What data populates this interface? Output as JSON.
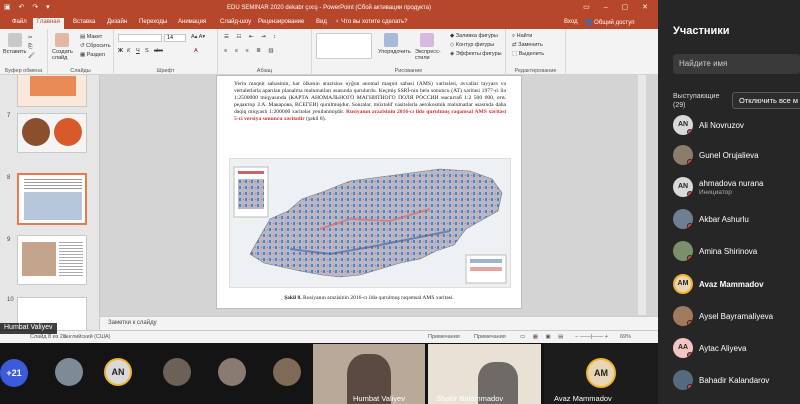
{
  "ppt": {
    "title": "EDU SEMINAR 2020 dekabr çıxış - PowerPoint (Сбой активации продукта)",
    "tabs": [
      "Файл",
      "Главная",
      "Вставка",
      "Дизайн",
      "Переходы",
      "Анимация",
      "Слайд-шоу",
      "Рецензирование",
      "Вид"
    ],
    "active_tab": "Главная",
    "tell_me": "♀ Что вы хотите сделать?",
    "sign_in": "Вход",
    "share": "Общий доступ",
    "ribbon": {
      "paste": "Вставить",
      "create_slide": "Создать слайд",
      "layout": "Макет",
      "reset": "Сбросить",
      "section": "Раздел",
      "font_size": "14",
      "arrange": "Упорядочить",
      "quick_styles": "Экспресс-стили",
      "shape_fill": "Заливка фигуры",
      "shape_outline": "Контур фигуры",
      "shape_effects": "Эффекты фигуры",
      "find": "Найти",
      "replace": "Заменить",
      "select": "Выделить",
      "groups": [
        "Буфер обмена",
        "Слайды",
        "Шрифт",
        "Абзац",
        "Рисование",
        "Редактирование"
      ]
    },
    "thumb_numbers": [
      "7",
      "8",
      "9",
      "10"
    ],
    "slide": {
      "paragraph": "Yerin maqnit sahəsinin, hər ölkənin ərazisinə uyğun anomal maqnit sahəsi (AMS) xəritələri, avvallar tayyarə və vertaletlərla aparılan planalma məlumatları əsasında qurulurdu. Keçmiş SSRİ-nin belə sonuncu (AT) xəritəsi 1977-ci ilə 1:2500000 miqyasında (КАРТА АНОМАЛЬНОГО МАГНИТНОГО ПОЛЯ РОССИИ масштаб 1:2 500 000, отв. редактор З.А. Макарова, ВСЕГЕИ) qurulmuşdur. Sonralar, müxtəlif vasitələrlə aerokosmik məlumatlar əsasında daha dəqiq miqyaslı 1:200000 xəritələr yenilənmişdir.",
      "red_text": "Rusiyanın ərazisinin 2016-cı ildə qurulmuş rəqəmsal AMS xəritəsi 5-ci versiya sonuncu xəritədir",
      "after_red": " (şəkil 8).",
      "caption_bold": "Şəkil 8.",
      "caption": " Rusiyanın ərazisinin 2016-cı ildə qurulmuş rəqəmsal AMS xəritəsi."
    },
    "notes": "Заметки к слайду",
    "status": {
      "slide": "Слайд 8 из 28",
      "lang": "английский (США)",
      "notes_btn": "Примечания",
      "comments_btn": "Примечания",
      "zoom": "69%"
    },
    "presenter_badge": "Humbat Valiyev"
  },
  "participants": {
    "title": "Участники",
    "search_placeholder": "Найдите имя",
    "speakers_label": "Выступающие",
    "speakers_count": "(29)",
    "mute_all": "Отключить все м",
    "list": [
      {
        "initials": "AN",
        "name": "Ali Novruzov",
        "role": "",
        "color": "#d9d9d9"
      },
      {
        "initials": "",
        "name": "Gunel Orujalieva",
        "role": "",
        "color": "#8b7d6b"
      },
      {
        "initials": "AN",
        "name": "ahmadova nurana",
        "role": "Инициатор",
        "color": "#d9d9d9"
      },
      {
        "initials": "",
        "name": "Akbar Ashurlu",
        "role": "",
        "color": "#6e7f92"
      },
      {
        "initials": "",
        "name": "Amina Shirinova",
        "role": "",
        "color": "#7a8f6a"
      },
      {
        "initials": "AM",
        "name": "Avaz Mammadov",
        "role": "",
        "color": "#e8d5b5"
      },
      {
        "initials": "",
        "name": "Aysel Bayramaliyeva",
        "role": "",
        "color": "#a07a5a"
      },
      {
        "initials": "AA",
        "name": "Aytac Aliyeva",
        "role": "",
        "color": "#f2c4c4"
      },
      {
        "initials": "",
        "name": "Bahadir Kalandarov",
        "role": "",
        "color": "#556b7d"
      }
    ]
  },
  "bottom_bar": {
    "more_count": "+21",
    "an_initials": "AN",
    "videos": [
      {
        "name": "Humbat Valiyev"
      },
      {
        "name": "Shakir Balammadov"
      },
      {
        "name": "Avaz Mammadov",
        "initials": "AM"
      }
    ]
  }
}
